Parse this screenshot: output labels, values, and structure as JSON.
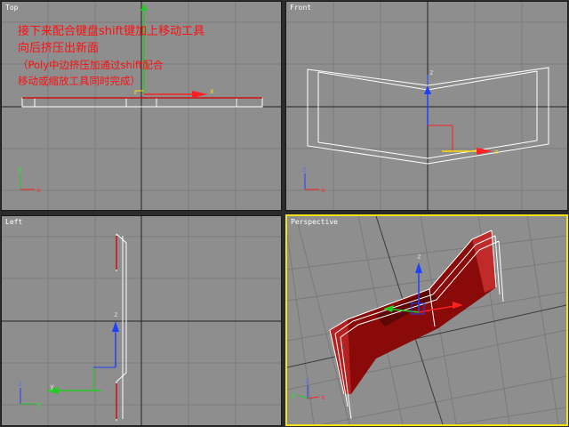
{
  "viewports": {
    "top": {
      "label": "Top"
    },
    "front": {
      "label": "Front"
    },
    "left": {
      "label": "Left"
    },
    "perspective": {
      "label": "Perspective",
      "active_border_color": "#f2e21a"
    }
  },
  "annotation": {
    "lines": [
      "接下来配合键盘shift键加上移动工具",
      "向后挤压出新面"
    ],
    "note_lines": [
      "（Poly中边挤压加通过shift配合",
      "移动或缩放工具同时完成）"
    ],
    "color": "#ff1010"
  },
  "axis_labels": {
    "x": "x",
    "y": "y",
    "z": "z"
  },
  "colors": {
    "viewport_bg": "#8e8e8e",
    "grid_line": "#7c7c7c",
    "center_line": "#222222",
    "wireframe": "#ffffff",
    "selected_edge": "#cc1010",
    "gizmo_x": "#ff2020",
    "gizmo_y": "#22cc22",
    "gizmo_z": "#2040ff",
    "mesh_fill": "#8a0a0a"
  }
}
